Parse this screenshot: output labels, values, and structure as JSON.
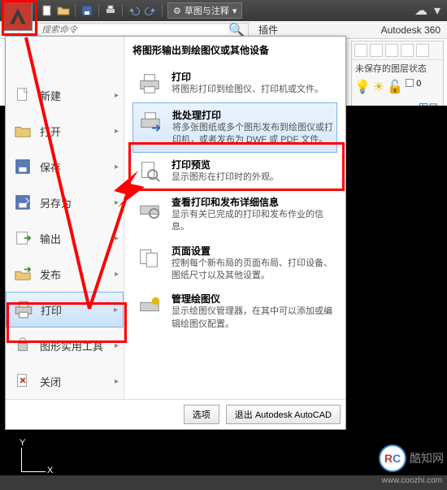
{
  "titlebar": {
    "workspace": "草图与注释",
    "autodesk360": "Autodesk 360",
    "plugin_tab": "插件"
  },
  "ribbon": {
    "search_placeholder": "搜索命令"
  },
  "right_panel": {
    "state": "未保存的图层状态",
    "link": "图层"
  },
  "appmenu": {
    "left": [
      {
        "label": "新建",
        "name": "new"
      },
      {
        "label": "打开",
        "name": "open"
      },
      {
        "label": "保存",
        "name": "save"
      },
      {
        "label": "另存为",
        "name": "saveas"
      },
      {
        "label": "输出",
        "name": "export"
      },
      {
        "label": "发布",
        "name": "publish"
      },
      {
        "label": "打印",
        "name": "print"
      },
      {
        "label": "图形实用工具",
        "name": "utilities"
      },
      {
        "label": "关闭",
        "name": "close"
      }
    ],
    "right": {
      "heading": "将图形输出到绘图仪或其他设备",
      "items": [
        {
          "title": "打印",
          "desc": "将图形打印到绘图仪、打印机或文件。",
          "name": "print-item"
        },
        {
          "title": "批处理打印",
          "desc": "将多张图纸或多个图形发布到绘图仪或打印机，或者发布为 DWF 或 PDF 文件。",
          "name": "batch-print-item"
        },
        {
          "title": "打印预览",
          "desc": "显示图形在打印时的外观。",
          "name": "preview-item"
        },
        {
          "title": "查看打印和发布详细信息",
          "desc": "显示有关已完成的打印和发布作业的信息。",
          "name": "details-item"
        },
        {
          "title": "页面设置",
          "desc": "控制每个新布局的页面布局、打印设备、图纸尺寸以及其他设置。",
          "name": "pagesetup-item"
        },
        {
          "title": "管理绘图仪",
          "desc": "显示绘图仪管理器，在其中可以添加或编辑绘图仪配置。",
          "name": "plotter-item"
        }
      ]
    },
    "footer": {
      "options": "选项",
      "exit": "退出 Autodesk AutoCAD"
    }
  },
  "canvas": {
    "x": "X",
    "y": "Y"
  },
  "watermark": {
    "brand": "酷知网",
    "url": "www.coozhi.com"
  }
}
